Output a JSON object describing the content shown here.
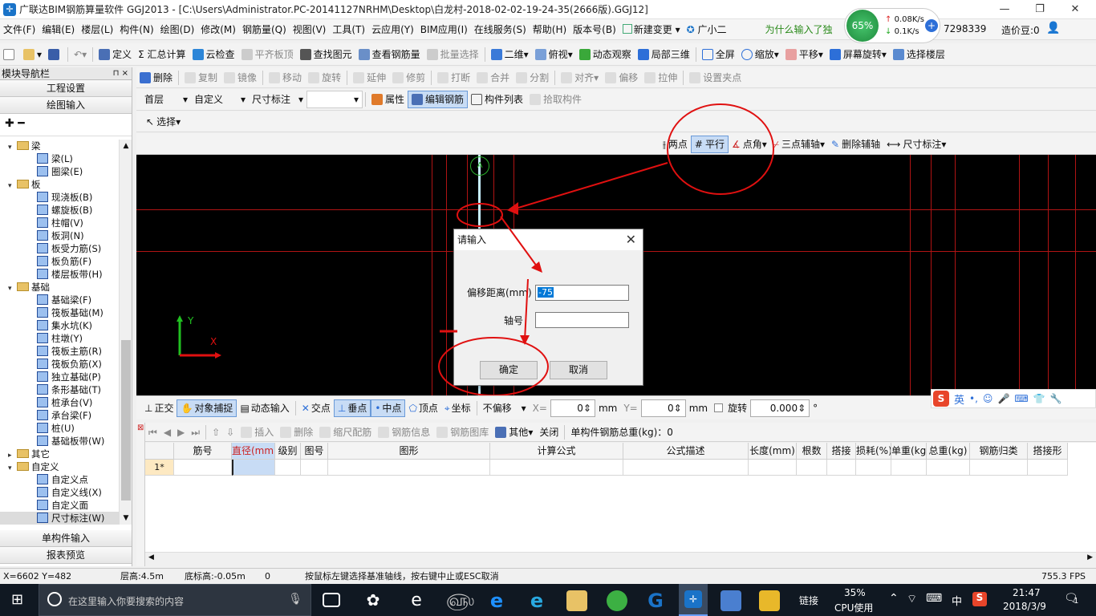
{
  "window": {
    "title": "广联达BIM钢筋算量软件 GGJ2013 - [C:\\Users\\Administrator.PC-20141127NRHM\\Desktop\\白龙村-2018-02-02-19-24-35(2666版).GGJ12]",
    "controls": [
      "—",
      "❐",
      "✕"
    ]
  },
  "menu": {
    "items": [
      "文件(F)",
      "编辑(E)",
      "楼层(L)",
      "构件(N)",
      "绘图(D)",
      "修改(M)",
      "钢筋量(Q)",
      "视图(V)",
      "工具(T)",
      "云应用(Y)",
      "BIM应用(I)",
      "在线服务(S)",
      "帮助(H)",
      "版本号(B)",
      "新建变更",
      "广小二"
    ],
    "banner": "为什么输入了独",
    "phone": "7298339",
    "cost_bean": "造价豆:0"
  },
  "net_widget": {
    "percent": "65%",
    "up": "0.08K/s",
    "down": "0.1K/s"
  },
  "toolbar1": {
    "items": [
      "定义",
      "Σ 汇总计算",
      "云检查",
      "平齐板顶",
      "查找图元",
      "查看钢筋量",
      "批量选择",
      "二维",
      "俯视",
      "动态观察",
      "局部三维",
      "全屏",
      "缩放",
      "平移",
      "屏幕旋转",
      "选择楼层"
    ]
  },
  "toolbar2": {
    "items": [
      "删除",
      "复制",
      "镜像",
      "移动",
      "旋转",
      "延伸",
      "修剪",
      "打断",
      "合并",
      "分割",
      "对齐",
      "偏移",
      "拉伸",
      "设置夹点"
    ]
  },
  "toolbar3": {
    "floor": "首层",
    "component": "自定义",
    "dim_type": "尺寸标注",
    "blank": "",
    "items": [
      "属性",
      "编辑钢筋",
      "构件列表",
      "拾取构件"
    ]
  },
  "toolbar4": {
    "select": "选择"
  },
  "axis_toolbar": {
    "items": [
      "两点",
      "平行",
      "点角",
      "三点辅轴",
      "删除辅轴",
      "尺寸标注"
    ]
  },
  "nav": {
    "title": "模块导航栏",
    "pin": "⊓ ×",
    "buttons_top": [
      "工程设置",
      "绘图输入"
    ],
    "buttons_bottom": [
      "单构件输入",
      "报表预览"
    ],
    "tree": [
      {
        "type": "folder",
        "label": "梁",
        "expanded": true
      },
      {
        "type": "item",
        "label": "梁(L)"
      },
      {
        "type": "item",
        "label": "圈梁(E)"
      },
      {
        "type": "folder",
        "label": "板",
        "expanded": true
      },
      {
        "type": "item",
        "label": "现浇板(B)"
      },
      {
        "type": "item",
        "label": "螺旋板(B)"
      },
      {
        "type": "item",
        "label": "柱帽(V)"
      },
      {
        "type": "item",
        "label": "板洞(N)"
      },
      {
        "type": "item",
        "label": "板受力筋(S)"
      },
      {
        "type": "item",
        "label": "板负筋(F)"
      },
      {
        "type": "item",
        "label": "楼层板带(H)"
      },
      {
        "type": "folder",
        "label": "基础",
        "expanded": true
      },
      {
        "type": "item",
        "label": "基础梁(F)"
      },
      {
        "type": "item",
        "label": "筏板基础(M)"
      },
      {
        "type": "item",
        "label": "集水坑(K)"
      },
      {
        "type": "item",
        "label": "柱墩(Y)"
      },
      {
        "type": "item",
        "label": "筏板主筋(R)"
      },
      {
        "type": "item",
        "label": "筏板负筋(X)"
      },
      {
        "type": "item",
        "label": "独立基础(P)"
      },
      {
        "type": "item",
        "label": "条形基础(T)"
      },
      {
        "type": "item",
        "label": "桩承台(V)"
      },
      {
        "type": "item",
        "label": "承台梁(F)"
      },
      {
        "type": "item",
        "label": "桩(U)"
      },
      {
        "type": "item",
        "label": "基础板带(W)"
      },
      {
        "type": "folder",
        "label": "其它",
        "expanded": false
      },
      {
        "type": "folder",
        "label": "自定义",
        "expanded": true
      },
      {
        "type": "item",
        "label": "自定义点"
      },
      {
        "type": "item",
        "label": "自定义线(X)"
      },
      {
        "type": "item",
        "label": "自定义面"
      },
      {
        "type": "item",
        "label": "尺寸标注(W)"
      }
    ]
  },
  "canvas": {
    "axis_x": "X",
    "axis_y": "Y",
    "axis_tag": "A"
  },
  "dialog": {
    "title": "请输入",
    "offset_label": "偏移距离(mm)",
    "offset_value": "-75",
    "axis_label": "轴号",
    "axis_value": "",
    "ok": "确定",
    "cancel": "取消"
  },
  "snap_toolbar": {
    "items": [
      "正交",
      "对象捕捉",
      "动态输入",
      "交点",
      "垂点",
      "中点",
      "顶点",
      "坐标"
    ],
    "offset_mode": "不偏移",
    "x_label": "X=",
    "x_value": "0",
    "y_label": "Y=",
    "y_value": "0",
    "unit": "mm",
    "rotate_label": "旋转",
    "rotate_value": "0.000",
    "degree": "°"
  },
  "ime": {
    "label": "英"
  },
  "grid_toolbar": {
    "items": [
      "插入",
      "删除",
      "缩尺配筋",
      "钢筋信息",
      "钢筋图库",
      "其他",
      "关闭"
    ],
    "total": "单构件钢筋总重(kg)：0"
  },
  "grid": {
    "columns": [
      "筋号",
      "直径(mm)",
      "级别",
      "图号",
      "图形",
      "计算公式",
      "公式描述",
      "长度(mm)",
      "根数",
      "搭接",
      "损耗(%)",
      "单重(kg)",
      "总重(kg)",
      "钢筋归类",
      "搭接形"
    ],
    "row_marker": "1*"
  },
  "status": {
    "coords": "X=6602 Y=482",
    "floor_height": "层高:4.5m",
    "base_height": "底标高:-0.05m",
    "zero": "0",
    "hint": "按鼠标左键选择基准轴线，按右键中止或ESC取消",
    "fps": "755.3 FPS"
  },
  "taskbar": {
    "search_placeholder": "在这里输入你要搜索的内容",
    "link": "链接",
    "cpu_percent": "35%",
    "cpu_label": "CPU使用",
    "ime": "中",
    "time": "21:47",
    "date": "2018/3/9",
    "notify": "1"
  },
  "colors": {
    "annotation": "#e01010",
    "canvas_bg": "#000000",
    "grid_line": "#b01414",
    "taskbar": "#101822",
    "highlight": "#c8dcf5"
  }
}
